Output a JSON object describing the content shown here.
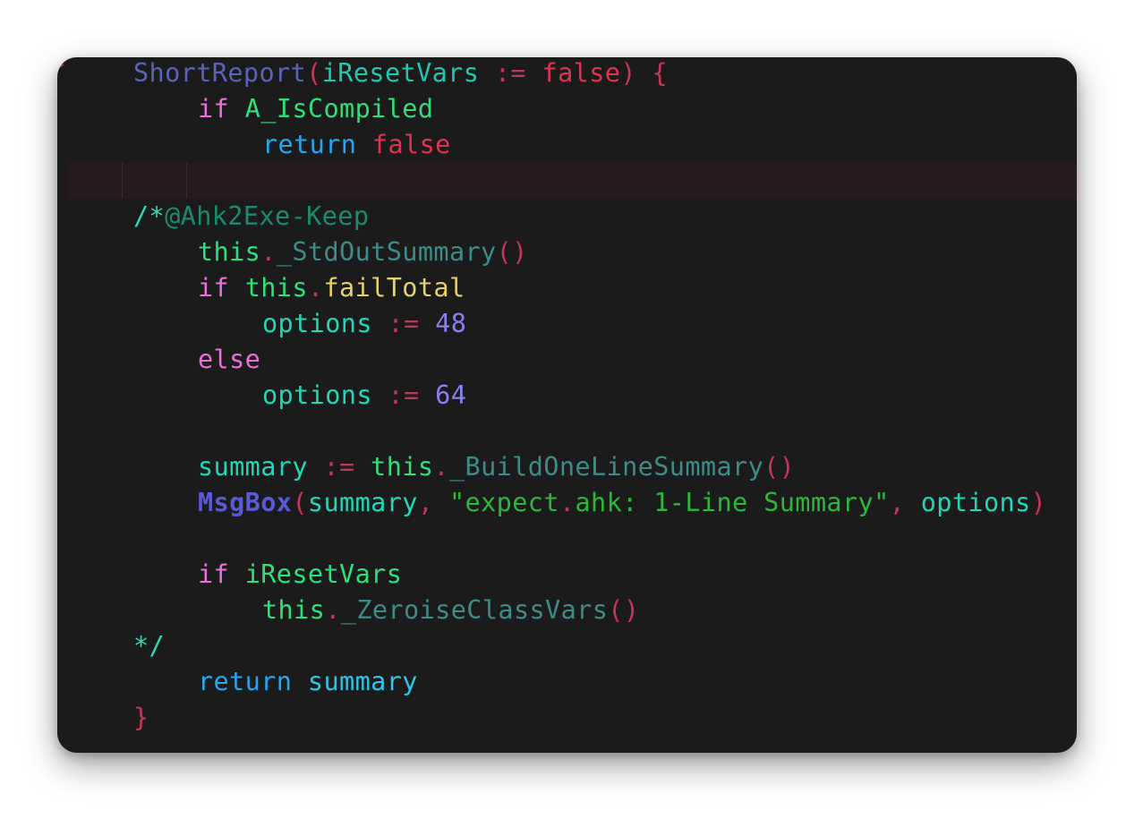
{
  "editor": {
    "lines": [
      {
        "indent": 1,
        "tokens": [
          {
            "t": "ShortReport",
            "c": "c-fn-dim"
          },
          {
            "t": "(",
            "c": "c-paren"
          },
          {
            "t": "iResetVars",
            "c": "c-param"
          },
          {
            "t": " := ",
            "c": "c-op"
          },
          {
            "t": "false",
            "c": "c-false"
          },
          {
            "t": ") {",
            "c": "c-paren"
          }
        ]
      },
      {
        "indent": 2,
        "tokens": [
          {
            "t": "if",
            "c": "c-kw"
          },
          {
            "t": " ",
            "c": "c-op"
          },
          {
            "t": "A_IsCompiled",
            "c": "c-green"
          }
        ]
      },
      {
        "indent": 3,
        "tokens": [
          {
            "t": "return",
            "c": "c-return"
          },
          {
            "t": " ",
            "c": "c-op"
          },
          {
            "t": "false",
            "c": "c-false"
          }
        ]
      },
      {
        "indent": 0,
        "current": true,
        "tokens": []
      },
      {
        "indent": 1,
        "tokens": [
          {
            "t": "/*",
            "c": "c-comment"
          },
          {
            "t": "@Ahk2Exe-Keep",
            "c": "c-cmt-txt"
          }
        ]
      },
      {
        "indent": 2,
        "tokens": [
          {
            "t": "this",
            "c": "c-this"
          },
          {
            "t": ".",
            "c": "c-dot"
          },
          {
            "t": "_StdOutSummary",
            "c": "c-method"
          },
          {
            "t": "()",
            "c": "c-paren"
          }
        ]
      },
      {
        "indent": 2,
        "tokens": [
          {
            "t": "if",
            "c": "c-kw"
          },
          {
            "t": " ",
            "c": "c-op"
          },
          {
            "t": "this",
            "c": "c-this"
          },
          {
            "t": ".",
            "c": "c-dot"
          },
          {
            "t": "failTotal",
            "c": "c-prop"
          }
        ]
      },
      {
        "indent": 3,
        "tokens": [
          {
            "t": "options",
            "c": "c-var"
          },
          {
            "t": " := ",
            "c": "c-op"
          },
          {
            "t": "48",
            "c": "c-num"
          }
        ]
      },
      {
        "indent": 2,
        "tokens": [
          {
            "t": "else",
            "c": "c-kw"
          }
        ]
      },
      {
        "indent": 3,
        "tokens": [
          {
            "t": "options",
            "c": "c-var"
          },
          {
            "t": " := ",
            "c": "c-op"
          },
          {
            "t": "64",
            "c": "c-num"
          }
        ]
      },
      {
        "indent": 0,
        "tokens": []
      },
      {
        "indent": 2,
        "tokens": [
          {
            "t": "summary",
            "c": "c-var"
          },
          {
            "t": " := ",
            "c": "c-op"
          },
          {
            "t": "this",
            "c": "c-this"
          },
          {
            "t": ".",
            "c": "c-dot"
          },
          {
            "t": "_BuildOneLineSummary",
            "c": "c-method"
          },
          {
            "t": "()",
            "c": "c-paren"
          }
        ]
      },
      {
        "indent": 2,
        "tokens": [
          {
            "t": "MsgBox",
            "c": "c-call"
          },
          {
            "t": "(",
            "c": "c-paren"
          },
          {
            "t": "summary",
            "c": "c-var"
          },
          {
            "t": ", ",
            "c": "c-op"
          },
          {
            "t": "\"expect",
            "c": "c-str"
          },
          {
            "t": ".",
            "c": "c-dot"
          },
          {
            "t": "ahk: 1-Line Summary\"",
            "c": "c-str"
          },
          {
            "t": ", ",
            "c": "c-op"
          },
          {
            "t": "options",
            "c": "c-var"
          },
          {
            "t": ")",
            "c": "c-paren"
          }
        ]
      },
      {
        "indent": 0,
        "tokens": []
      },
      {
        "indent": 2,
        "tokens": [
          {
            "t": "if",
            "c": "c-kw"
          },
          {
            "t": " ",
            "c": "c-op"
          },
          {
            "t": "iResetVars",
            "c": "c-green"
          }
        ]
      },
      {
        "indent": 3,
        "tokens": [
          {
            "t": "this",
            "c": "c-this"
          },
          {
            "t": ".",
            "c": "c-dot"
          },
          {
            "t": "_ZeroiseClassVars",
            "c": "c-method"
          },
          {
            "t": "()",
            "c": "c-paren"
          }
        ]
      },
      {
        "indent": 1,
        "tokens": [
          {
            "t": "*/",
            "c": "c-comment"
          }
        ]
      },
      {
        "indent": 2,
        "tokens": [
          {
            "t": "return",
            "c": "c-return"
          },
          {
            "t": " ",
            "c": "c-op"
          },
          {
            "t": "summary",
            "c": "c-ret-var"
          }
        ]
      },
      {
        "indent": 1,
        "tokens": [
          {
            "t": "}",
            "c": "c-paren"
          }
        ]
      }
    ]
  }
}
